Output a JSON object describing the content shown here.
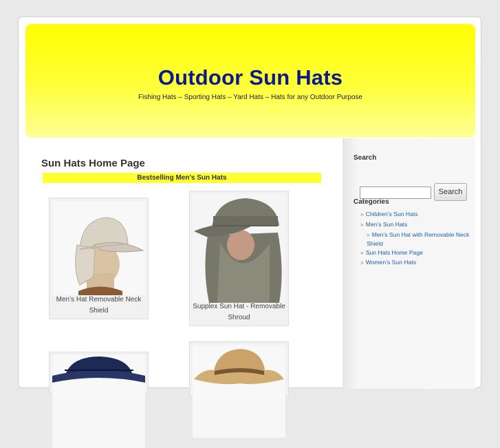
{
  "header": {
    "site_title": "Outdoor Sun Hats",
    "site_description": "Fishing Hats – Sporting Hats – Yard Hats – Hats for any Outdoor Purpose",
    "gradient_colors": [
      "#ffff00",
      "#ffff9a"
    ],
    "title_color": "#0a1a8a"
  },
  "main": {
    "page_title": "Sun Hats Home Page",
    "bestselling_heading": "Bestselling Men’s Sun Hats",
    "products": [
      {
        "caption": "Men’s Hat Removable Neck Shield",
        "image": "beige-hat-on-mannequin"
      },
      {
        "caption": "Supplex Sun Hat - Removable Shroud",
        "image": "green-hat-with-shroud"
      },
      {
        "caption": "",
        "image": "navy-bucket-hat"
      },
      {
        "caption": "",
        "image": "straw-cowboy-hat"
      }
    ]
  },
  "sidebar": {
    "search": {
      "heading": "Search",
      "placeholder": "",
      "button_label": "Search"
    },
    "categories": {
      "heading": "Categories",
      "bullet": "»",
      "items": [
        {
          "label": "Children’s Sun Hats"
        },
        {
          "label": "Men’s Sun Hats"
        },
        {
          "label": "Men’s Sun Hat with Removable Neck Shield"
        },
        {
          "label": "Sun Hats Home Page"
        },
        {
          "label": "Women’s Sun Hats"
        }
      ],
      "link_color": "#1e5fa8"
    }
  }
}
